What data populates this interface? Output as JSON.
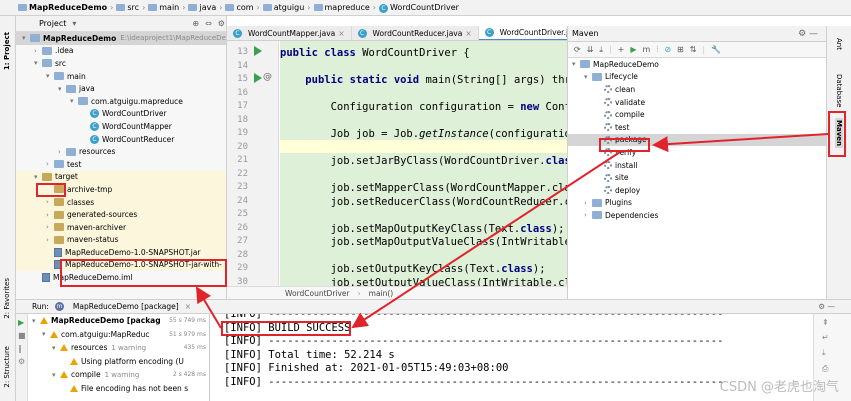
{
  "breadcrumb": [
    "MapReduceDemo",
    "src",
    "main",
    "java",
    "com",
    "atguigu",
    "mapreduce",
    "WordCountDriver"
  ],
  "project_panel": {
    "title": "Project",
    "tree": [
      {
        "indent": 0,
        "twisty": "▾",
        "icon": "module",
        "label": "MapReduceDemo",
        "extra": "E:\\ideaproject1\\MapReduceDe",
        "bold": true
      },
      {
        "indent": 1,
        "twisty": "›",
        "icon": "folder",
        "label": ".idea"
      },
      {
        "indent": 1,
        "twisty": "▾",
        "icon": "folder",
        "label": "src"
      },
      {
        "indent": 2,
        "twisty": "▾",
        "icon": "folder",
        "label": "main"
      },
      {
        "indent": 3,
        "twisty": "▾",
        "icon": "folder-src",
        "label": "java"
      },
      {
        "indent": 4,
        "twisty": "▾",
        "icon": "package",
        "label": "com.atguigu.mapreduce"
      },
      {
        "indent": 5,
        "twisty": "",
        "icon": "class",
        "label": "WordCountDriver"
      },
      {
        "indent": 5,
        "twisty": "",
        "icon": "class",
        "label": "WordCountMapper"
      },
      {
        "indent": 5,
        "twisty": "",
        "icon": "class",
        "label": "WordCountReducer"
      },
      {
        "indent": 3,
        "twisty": "›",
        "icon": "folder",
        "label": "resources"
      },
      {
        "indent": 2,
        "twisty": "›",
        "icon": "folder",
        "label": "test"
      },
      {
        "indent": 1,
        "twisty": "▾",
        "icon": "folder-target",
        "label": "target"
      },
      {
        "indent": 2,
        "twisty": "",
        "icon": "folder-target",
        "label": "archive-tmp"
      },
      {
        "indent": 2,
        "twisty": "›",
        "icon": "folder-target",
        "label": "classes"
      },
      {
        "indent": 2,
        "twisty": "›",
        "icon": "folder-target",
        "label": "generated-sources"
      },
      {
        "indent": 2,
        "twisty": "›",
        "icon": "folder-target",
        "label": "maven-archiver"
      },
      {
        "indent": 2,
        "twisty": "›",
        "icon": "folder-target",
        "label": "maven-status"
      },
      {
        "indent": 2,
        "twisty": "",
        "icon": "jar",
        "label": "MapReduceDemo-1.0-SNAPSHOT.jar"
      },
      {
        "indent": 2,
        "twisty": "",
        "icon": "jar",
        "label": "MapReduceDemo-1.0-SNAPSHOT-jar-with-"
      },
      {
        "indent": 1,
        "twisty": "",
        "icon": "iml",
        "label": "MapReduceDemo.iml"
      }
    ]
  },
  "editor": {
    "tabs": [
      {
        "label": "WordCountMapper.java",
        "active": false
      },
      {
        "label": "WordCountReducer.java",
        "active": false
      },
      {
        "label": "WordCountDriver.java",
        "active": true
      }
    ],
    "line_numbers": [
      "13",
      "14",
      "15",
      "16",
      "17",
      "18",
      "19",
      "20",
      "21",
      "22",
      "23",
      "24",
      "25",
      "26",
      "27",
      "28",
      "29",
      "30",
      "31"
    ],
    "code": [
      "public class WordCountDriver {",
      "",
      "    public static void main(String[] args) thro",
      "",
      "        Configuration configuration = new Confi",
      "",
      "        Job job = Job.getInstance(configuration",
      "",
      "        job.setJarByClass(WordCountDriver.class",
      "",
      "        job.setMapperClass(WordCountMapper.clas",
      "        job.setReducerClass(WordCountReducer.cl",
      "",
      "        job.setMapOutputKeyClass(Text.class);",
      "        job.setMapOutputValueClass(IntWritable.",
      "",
      "        job.setOutputKeyClass(Text.class);",
      "        job.setOutputValueClass(IntWritable.cla"
    ],
    "footer": [
      "WordCountDriver",
      "main()"
    ]
  },
  "maven": {
    "title": "Maven",
    "tree": [
      {
        "indent": 0,
        "twisty": "▾",
        "label": "MapReduceDemo",
        "icon": "module"
      },
      {
        "indent": 1,
        "twisty": "▾",
        "label": "Lifecycle",
        "icon": "folder"
      },
      {
        "indent": 2,
        "label": "clean",
        "icon": "gear"
      },
      {
        "indent": 2,
        "label": "validate",
        "icon": "gear"
      },
      {
        "indent": 2,
        "label": "compile",
        "icon": "gear"
      },
      {
        "indent": 2,
        "label": "test",
        "icon": "gear"
      },
      {
        "indent": 2,
        "label": "package",
        "icon": "gear",
        "selected": true
      },
      {
        "indent": 2,
        "label": "verify",
        "icon": "gear"
      },
      {
        "indent": 2,
        "label": "install",
        "icon": "gear"
      },
      {
        "indent": 2,
        "label": "site",
        "icon": "gear"
      },
      {
        "indent": 2,
        "label": "deploy",
        "icon": "gear"
      },
      {
        "indent": 1,
        "twisty": "›",
        "label": "Plugins",
        "icon": "folder"
      },
      {
        "indent": 1,
        "twisty": "›",
        "label": "Dependencies",
        "icon": "folder"
      }
    ]
  },
  "right_strip": [
    "Ant",
    "Database",
    "Maven"
  ],
  "left_strip": [
    "1: Project",
    "2: Favorites",
    "2: Structure"
  ],
  "run": {
    "label": "Run:",
    "tab": "MapReduceDemo [package]",
    "tree": [
      {
        "indent": 0,
        "label": "MapReduceDemo [packag",
        "time": "55 s 749 ms"
      },
      {
        "indent": 1,
        "label": "com.atguigu:MapReduc",
        "time": "51 s 979 ms"
      },
      {
        "indent": 2,
        "label": "resources",
        "extra": "1 warning",
        "time": "435 ms"
      },
      {
        "indent": 3,
        "label": "Using platform encoding (U",
        "time": ""
      },
      {
        "indent": 2,
        "label": "compile",
        "extra": "1 warning",
        "time": "2 s 428 ms"
      },
      {
        "indent": 3,
        "label": "File encoding has not been s",
        "time": ""
      }
    ],
    "console": [
      "[INFO] ------------------------------------------------------------------------",
      "[INFO] BUILD SUCCESS",
      "[INFO] ------------------------------------------------------------------------",
      "[INFO] Total time: 52.214 s",
      "[INFO] Finished at: 2021-01-05T15:49:03+08:00",
      "[INFO] ------------------------------------------------------------------------"
    ]
  },
  "watermark": "CSDN @老虎也淘气",
  "colors": {
    "highlight": "#e0242c",
    "code_bg": "#dff0d8",
    "selection": "#d5d5d5"
  }
}
